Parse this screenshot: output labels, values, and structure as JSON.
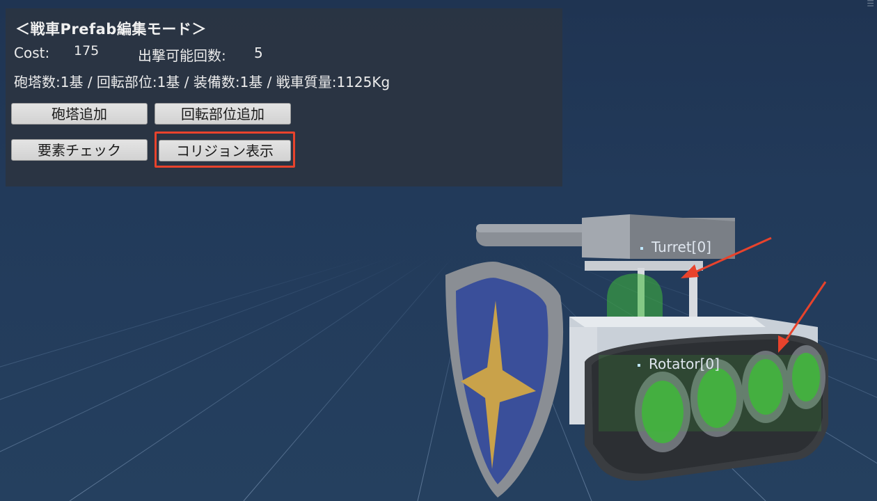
{
  "panel": {
    "title": "＜戦車Prefab編集モード＞",
    "cost_label": "Cost:",
    "cost_value": "175",
    "sortie_label": "出撃可能回数:",
    "sortie_value": "5",
    "stats_line": "砲塔数:1基 / 回転部位:1基 / 装備数:1基 / 戦車質量:1125Kg",
    "buttons": {
      "add_turret": "砲塔追加",
      "add_rotator": "回転部位追加",
      "check_elements": "要素チェック",
      "show_collision": "コリジョン表示"
    }
  },
  "scene": {
    "turret_label": "Turret[0]",
    "rotator_label": "Rotator[0]",
    "annotation_color": "#e8432c",
    "collider_color": "#3fb83a",
    "shield_color": "#3a4f9a",
    "emblem_color": "#c9a24a"
  }
}
